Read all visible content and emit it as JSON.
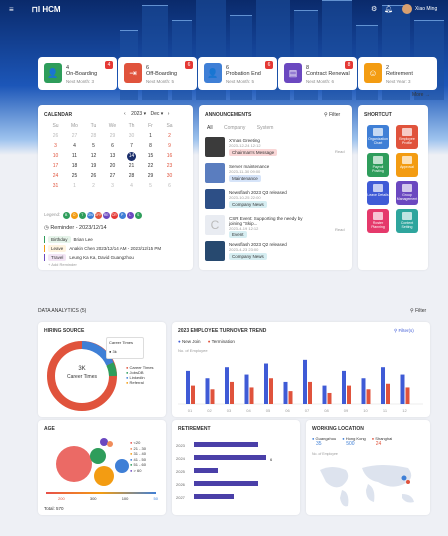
{
  "app": {
    "logo": "HCM",
    "user": "Xiao Ming"
  },
  "stats": [
    {
      "title": "On-Boarding",
      "count": "4",
      "sub": "Next Month: 3",
      "badge": "4",
      "color": "#2e9d5b",
      "icon": "👤"
    },
    {
      "title": "Off-Boarding",
      "count": "6",
      "sub": "Next Month: 5",
      "badge": "6",
      "color": "#e0533c",
      "icon": "⇥"
    },
    {
      "title": "Probation End",
      "count": "6",
      "sub": "Next Month: 5",
      "badge": "6",
      "color": "#3f7fd6",
      "icon": "👤"
    },
    {
      "title": "Contract Renewal",
      "count": "8",
      "sub": "Next Month: 6",
      "badge": "8",
      "color": "#6b48c0",
      "icon": "▤"
    },
    {
      "title": "Retirement",
      "count": "2",
      "sub": "Next Year: 3",
      "badge": "",
      "color": "#f39c12",
      "icon": "☺"
    }
  ],
  "more": "More →",
  "calendar": {
    "title": "CALENDAR",
    "year": "2023",
    "month": "Dec",
    "weekdays": [
      "Su",
      "Mo",
      "Tu",
      "We",
      "Th",
      "Fr",
      "Sa"
    ],
    "rows": [
      [
        "26",
        "27",
        "28",
        "29",
        "30",
        "1",
        "2"
      ],
      [
        "3",
        "4",
        "5",
        "6",
        "7",
        "8",
        "9"
      ],
      [
        "10",
        "11",
        "12",
        "13",
        "14",
        "15",
        "16"
      ],
      [
        "17",
        "18",
        "19",
        "20",
        "21",
        "22",
        "23"
      ],
      [
        "24",
        "25",
        "26",
        "27",
        "28",
        "29",
        "30"
      ],
      [
        "31",
        "1",
        "2",
        "3",
        "4",
        "5",
        "6"
      ]
    ],
    "legend_label": "Legend:",
    "legend": [
      "B",
      "O",
      "T",
      "ON",
      "OFF",
      "RE",
      "CR",
      "P",
      "L",
      "S"
    ],
    "legend_colors": [
      "#2e9d5b",
      "#f39c12",
      "#2e9d5b",
      "#3f7fd6",
      "#e0533c",
      "#6b48c0",
      "#e53935",
      "#3f7fd6",
      "#6b48c0",
      "#2e9d5b"
    ],
    "reminder": "Reminder - 2023/12/14",
    "events": [
      {
        "tag": "Birthday",
        "text": "Brian Lee"
      },
      {
        "tag": "Leave",
        "text": "Anakin Chen 2023/12/14 AM - 2023/12/15 PM"
      },
      {
        "tag": "Travel",
        "text": "Leung Ka Ka, David Guangzhou"
      }
    ],
    "add": "+ Add Reminder"
  },
  "announcements": {
    "title": "ANNOUNCEMENTS",
    "filter": "Filter",
    "tabs": [
      "All",
      "Company",
      "System"
    ],
    "items": [
      {
        "title": "X'mas Greeting",
        "date": "2023-12-24 12:12",
        "tag": "Chairman's Message",
        "read": "Read"
      },
      {
        "title": "Server maintenance",
        "date": "2023-11-30 09:00",
        "tag": "Maintenance"
      },
      {
        "title": "Newsflash 2023 Q3 released",
        "date": "2023-10-25 22:00",
        "tag": "Company News"
      },
      {
        "title": "CSR Event: Supporting the needy by joining \"Skip...",
        "date": "2023-4-19 12:12",
        "tag": "Event",
        "read": "Read"
      },
      {
        "title": "Newsflash 2023 Q2 released",
        "date": "2023-4-23 23:00",
        "tag": "Company News"
      }
    ]
  },
  "shortcut": {
    "title": "SHORTCUT",
    "items": [
      {
        "label": "Organization Chart",
        "color": "#3f7fd6"
      },
      {
        "label": "Employee Profile",
        "color": "#e0533c"
      },
      {
        "label": "Payroll Posting",
        "color": "#2e9d5b"
      },
      {
        "label": "Approval",
        "color": "#f39c12"
      },
      {
        "label": "Leave Details",
        "color": "#3f5bd6"
      },
      {
        "label": "Group Management",
        "color": "#6b48c0"
      },
      {
        "label": "Roster Planning",
        "color": "#e5396b"
      },
      {
        "label": "Content Setting",
        "color": "#2ea59d"
      }
    ]
  },
  "analytics": {
    "title": "DATA ANALYTICS (5)",
    "filter": "Filter"
  },
  "hiring": {
    "title": "HIRING SOURCE",
    "center_value": "3K",
    "center_label": "Career Times",
    "legend_title": "Career Times",
    "legend_value": "3k",
    "legend": [
      "Career Times",
      "JobsDB",
      "LinkedIn",
      "Referral"
    ],
    "legend_colors": [
      "#e0533c",
      "#2e9d5b",
      "#3f7fd6",
      "#f39c12"
    ]
  },
  "turnover": {
    "title": "2023 EMPLOYEE TURNOVER TREND",
    "filter": "Filter(s)",
    "legend_new": "New Join",
    "legend_term": "Termination",
    "ylabel": "No. of Employee"
  },
  "chart_data": {
    "type": "bar",
    "title": "2023 EMPLOYEE TURNOVER TREND",
    "ylabel": "No. of Employee",
    "categories": [
      "01",
      "02",
      "03",
      "04",
      "05",
      "06",
      "07",
      "08",
      "09",
      "10",
      "11",
      "12"
    ],
    "series": [
      {
        "name": "New Join",
        "values": [
          18,
          14,
          20,
          16,
          22,
          12,
          24,
          10,
          18,
          14,
          20,
          16
        ]
      },
      {
        "name": "Termination",
        "values": [
          10,
          8,
          12,
          9,
          14,
          7,
          12,
          6,
          10,
          8,
          11,
          9
        ]
      }
    ]
  },
  "age": {
    "title": "AGE",
    "legend": [
      "<20",
      "21 - 30",
      "31 - 40",
      "41 - 50",
      "51 - 60",
      "> 60"
    ],
    "legend_colors": [
      "#e8504a",
      "#f08c5a",
      "#f39c12",
      "#3f7fd6",
      "#2e9d5b",
      "#6b48c0"
    ],
    "axis": [
      "200",
      "300",
      "100",
      "50"
    ],
    "total": "Total: 570"
  },
  "retirement": {
    "title": "RETIREMENT",
    "years": [
      "2023",
      "2024",
      "2025",
      "2026",
      "2027"
    ],
    "values": [
      8,
      9,
      3,
      8,
      5
    ],
    "tooltip": "6"
  },
  "location": {
    "title": "WORKING LOCATION",
    "cities": [
      {
        "name": "Guangzhou",
        "value": "35",
        "color": "#3f7fd6"
      },
      {
        "name": "Hong Kong",
        "value": "500",
        "color": "#3f7fd6"
      },
      {
        "name": "Shanghai",
        "value": "24",
        "color": "#e0533c"
      }
    ],
    "ylabel": "No. of Employee"
  }
}
